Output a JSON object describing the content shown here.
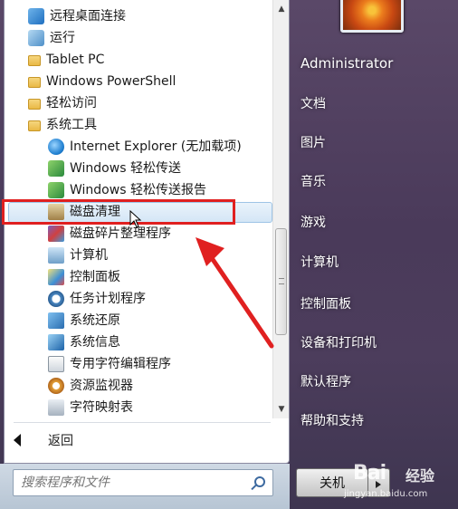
{
  "start_menu": {
    "program_list": [
      {
        "label": "远程桌面连接",
        "icon": "remote-desktop-icon",
        "level": 0
      },
      {
        "label": "运行",
        "icon": "run-icon",
        "level": 0
      },
      {
        "label": "Tablet PC",
        "icon": "folder-icon",
        "level": 0
      },
      {
        "label": "Windows PowerShell",
        "icon": "folder-icon",
        "level": 0
      },
      {
        "label": "轻松访问",
        "icon": "folder-icon",
        "level": 0
      },
      {
        "label": "系统工具",
        "icon": "folder-icon",
        "level": 0
      },
      {
        "label": "Internet Explorer (无加载项)",
        "icon": "internet-explorer-icon",
        "level": 1
      },
      {
        "label": "Windows 轻松传送",
        "icon": "easy-transfer-icon",
        "level": 1
      },
      {
        "label": "Windows 轻松传送报告",
        "icon": "easy-transfer-icon",
        "level": 1
      },
      {
        "label": "磁盘清理",
        "icon": "disk-cleanup-icon",
        "level": 1,
        "selected": true
      },
      {
        "label": "磁盘碎片整理程序",
        "icon": "defragmenter-icon",
        "level": 1
      },
      {
        "label": "计算机",
        "icon": "computer-icon",
        "level": 1
      },
      {
        "label": "控制面板",
        "icon": "control-panel-icon",
        "level": 1
      },
      {
        "label": "任务计划程序",
        "icon": "task-scheduler-icon",
        "level": 1
      },
      {
        "label": "系统还原",
        "icon": "system-restore-icon",
        "level": 1
      },
      {
        "label": "系统信息",
        "icon": "system-info-icon",
        "level": 1
      },
      {
        "label": "专用字符编辑程序",
        "icon": "private-char-editor-icon",
        "level": 1
      },
      {
        "label": "资源监视器",
        "icon": "resource-monitor-icon",
        "level": 1
      },
      {
        "label": "字符映射表",
        "icon": "character-map-icon",
        "level": 1
      }
    ],
    "back_label": "返回",
    "search_placeholder": "搜索程序和文件",
    "right_links": {
      "user": "Administrator",
      "documents": "文档",
      "pictures": "图片",
      "music": "音乐",
      "games": "游戏",
      "computer": "计算机",
      "control_panel": "控制面板",
      "devices_printers": "设备和打印机",
      "default_programs": "默认程序",
      "help_support": "帮助和支持"
    },
    "shutdown_label": "关机"
  },
  "watermark": {
    "brand": "Bai",
    "brand_suffix": "经验",
    "url": "jingyan.baidu.com"
  },
  "colors": {
    "highlight_border": "#e02020",
    "annotation_arrow": "#e02020"
  }
}
